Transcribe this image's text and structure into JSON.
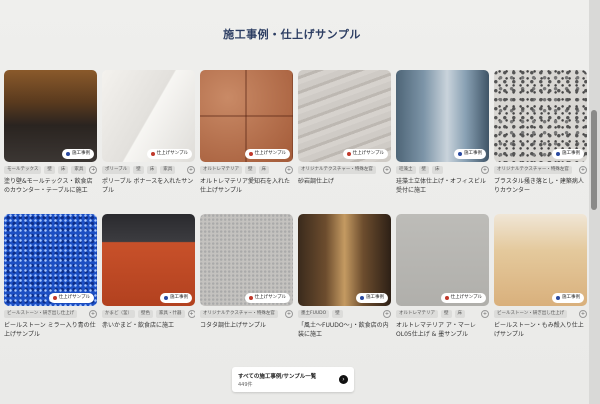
{
  "section": {
    "title": "施工事例・仕上げサンプル"
  },
  "cards": [
    {
      "badge": "施工事例",
      "dot": "blue",
      "tags": [
        "モールテックス",
        "壁",
        "床",
        "家具"
      ],
      "caption": "塗り壁&モールテックス・飲食店のカウンター・テーブルに施工"
    },
    {
      "badge": "仕上げサンプル",
      "dot": "red",
      "tags": [
        "ポリーブル",
        "壁",
        "床",
        "家具"
      ],
      "caption": "ポリーブル ボナースを入れたサンプル"
    },
    {
      "badge": "仕上げサンプル",
      "dot": "red",
      "tags": [
        "オルトレマテリア",
        "壁",
        "床"
      ],
      "caption": "オルトレマテリア愛知石を入れた仕上げサンプル"
    },
    {
      "badge": "仕上げサンプル",
      "dot": "red",
      "tags": [
        "オリジナルテクスチャー・特殊左官"
      ],
      "caption": "砂岩調仕上げ"
    },
    {
      "badge": "施工事例",
      "dot": "blue",
      "tags": [
        "珪藻土",
        "壁",
        "床"
      ],
      "caption": "珪藻土立体仕上げ・オフィスビル受付に施工"
    },
    {
      "badge": "施工事例",
      "dot": "blue",
      "tags": [
        "オリジナルテクスチャー・特殊左官"
      ],
      "caption": "ブラスタル掻き落とし・建築病人りカウンター"
    },
    {
      "badge": "仕上げサンプル",
      "dot": "red",
      "tags": [
        "ビールストーン・研ぎ出し仕上げ"
      ],
      "caption": "ビールストーン ミラー入り青の仕上げサンプル"
    },
    {
      "badge": "施工事例",
      "dot": "blue",
      "tags": [
        "かまど（釜）",
        "壁色",
        "家具・什器"
      ],
      "caption": "赤いかまど・飲食店に施工"
    },
    {
      "badge": "仕上げサンプル",
      "dot": "red",
      "tags": [
        "オリジナルテクスチャー・特殊左官"
      ],
      "caption": "コタタ調仕上げサンプル"
    },
    {
      "badge": "施工事例",
      "dot": "blue",
      "tags": [
        "墨土FUUDO",
        "壁"
      ],
      "caption": "「風土〜FUUDO〜」・飲食店の内装に施工"
    },
    {
      "badge": "仕上げサンプル",
      "dot": "red",
      "tags": [
        "オルトレマテリア",
        "壁",
        "床"
      ],
      "caption": "オルトレマテリア ア・マーレOL05仕上げ & 墨サンプル"
    },
    {
      "badge": "施工事例",
      "dot": "blue",
      "tags": [
        "ビールストーン・研ぎ出し仕上げ"
      ],
      "caption": "ビールストーン・もみ殻入り仕上げサンプル"
    }
  ],
  "cta": {
    "title": "すべての施工事例/サンプル一覧",
    "count": "449件",
    "arrow": "›"
  },
  "icons": {
    "more": "+",
    "badge_dot": "circle"
  },
  "colors": {
    "accent": "#2d3e63",
    "dot_blue": "#2a4aa0",
    "dot_red": "#c0392b"
  }
}
